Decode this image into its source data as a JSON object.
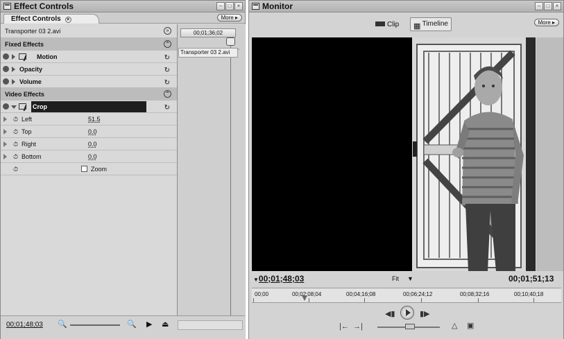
{
  "effect_controls": {
    "title": "Effect Controls",
    "tab_label": "Effect Controls",
    "more_label": "More",
    "clip_name": "Transporter 03 2.avi",
    "fixed_effects_label": "Fixed Effects",
    "fixed_effects": [
      {
        "name": "Motion"
      },
      {
        "name": "Opacity"
      },
      {
        "name": "Volume"
      }
    ],
    "video_effects_label": "Video Effects",
    "crop": {
      "name": "Crop",
      "params": [
        {
          "name": "Left",
          "value": "51.5"
        },
        {
          "name": "Top",
          "value": "0.0"
        },
        {
          "name": "Right",
          "value": "0.0"
        },
        {
          "name": "Bottom",
          "value": "0.0"
        }
      ],
      "zoom_label": "Zoom",
      "zoom_checked": false
    },
    "timeline_timecode": "00;01;36;02",
    "timeline_clip": "Transporter 03 2.avi",
    "bottom_timecode": "00;01;48;03"
  },
  "monitor": {
    "title": "Monitor",
    "clip_tab": "Clip",
    "timeline_tab": "Timeline",
    "more_label": "More",
    "current_timecode": "00;01;48;03",
    "fit_label": "Fit",
    "duration_timecode": "00;01;51;13",
    "ruler_labels": [
      "00;00",
      "00;02;08;04",
      "00;04;16;08",
      "00;06;24;12",
      "00;08;32;16",
      "00;10;40;18"
    ],
    "playhead_fraction": 0.17,
    "crop_left_percent": 51.5
  }
}
